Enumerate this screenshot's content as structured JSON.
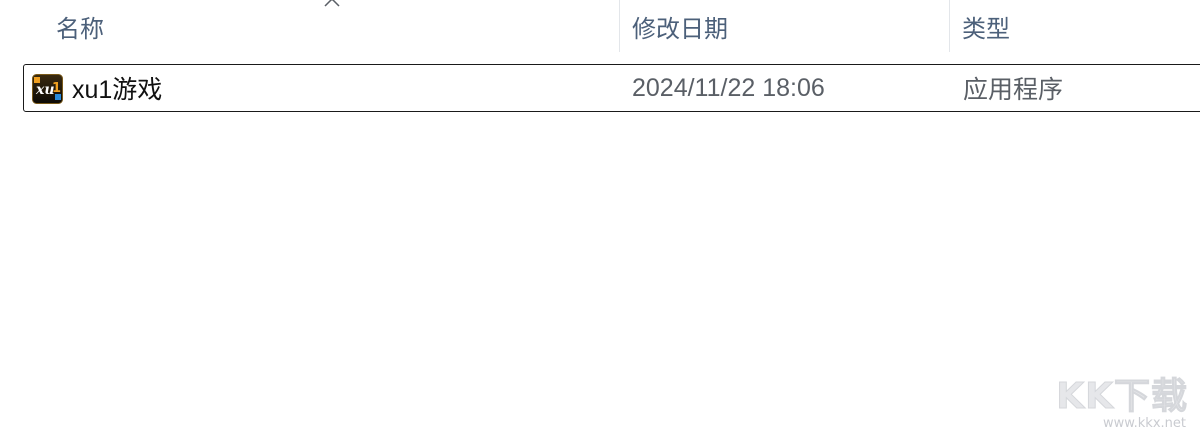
{
  "columns": {
    "name": "名称",
    "date_modified": "修改日期",
    "type": "类型"
  },
  "sort": {
    "column": "name",
    "direction": "ascending",
    "icon": "chevron-up-icon"
  },
  "files": [
    {
      "name": "xu1游戏",
      "date_modified": "2024/11/22 18:06",
      "type": "应用程序",
      "icon": "xu1-app-icon",
      "selected": true
    }
  ],
  "watermark": {
    "text": "KK下载",
    "url": "www.kkx.net"
  },
  "colors": {
    "header_text": "#4c607a",
    "selection_border": "#1a1a1a",
    "secondary_text": "#5a5f66",
    "icon_orange": "#f0a020"
  }
}
